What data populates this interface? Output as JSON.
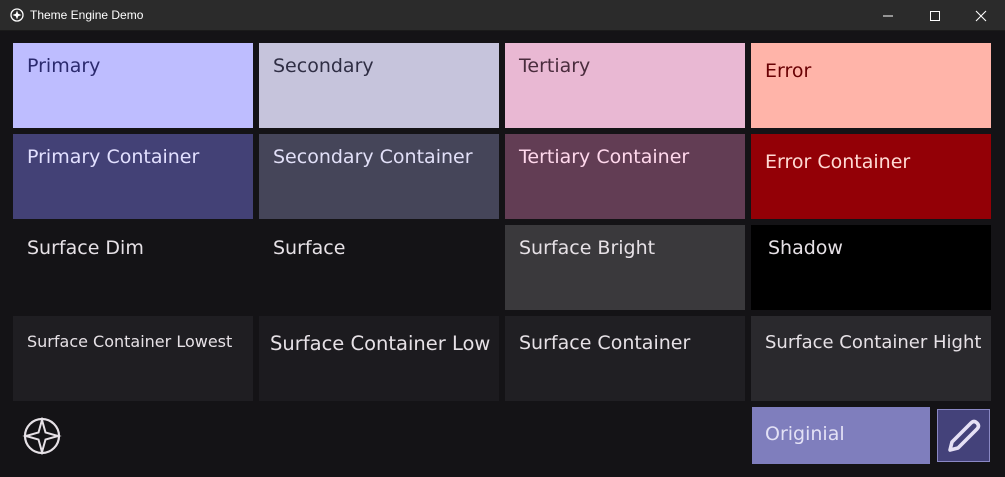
{
  "window": {
    "title": "Theme Engine Demo"
  },
  "tiles": [
    {
      "label": "Primary",
      "bg": "#bebdff",
      "fg": "#2b2a6e"
    },
    {
      "label": "Secondary",
      "bg": "#c6c4dc",
      "fg": "#2f2e44"
    },
    {
      "label": "Tertiary",
      "bg": "#e9b8d3",
      "fg": "#4a2c3d"
    },
    {
      "label": "Error",
      "bg": "#ffb4a9",
      "fg": "#690003"
    },
    {
      "label": "Primary Container",
      "bg": "#434176",
      "fg": "#e2e0ff"
    },
    {
      "label": "Secondary Container",
      "bg": "#454559",
      "fg": "#e2e0f8"
    },
    {
      "label": "Tertiary Container",
      "bg": "#623d54",
      "fg": "#ffd8ec"
    },
    {
      "label": "Error Container",
      "bg": "#930006",
      "fg": "#ffdad4"
    },
    {
      "label": "Surface Dim",
      "bg": "#141316",
      "fg": "#e6e1e6"
    },
    {
      "label": "Surface",
      "bg": "#141316",
      "fg": "#e6e1e6"
    },
    {
      "label": "Surface Bright",
      "bg": "#3a393c",
      "fg": "#e6e1e6"
    },
    {
      "label": "Shadow",
      "bg": "#000000",
      "fg": "#e6e1e6"
    },
    {
      "label": "Surface Container Lowest",
      "bg": "#1f1e22",
      "fg": "#e6e1e6"
    },
    {
      "label": "Surface Container Low",
      "bg": "#1c1b1f",
      "fg": "#e6e1e6"
    },
    {
      "label": "Surface Container",
      "bg": "#201f23",
      "fg": "#e6e1e6"
    },
    {
      "label": "Surface Container Hight",
      "bg": "#2a292d",
      "fg": "#e6e1e6"
    }
  ],
  "actions": {
    "original_label": "Originial"
  },
  "icons": {
    "app": "theme-engine-icon",
    "minimize": "minimize-icon",
    "maximize": "maximize-icon",
    "close": "close-icon",
    "logo": "compass-star-icon",
    "edit": "pencil-icon"
  }
}
